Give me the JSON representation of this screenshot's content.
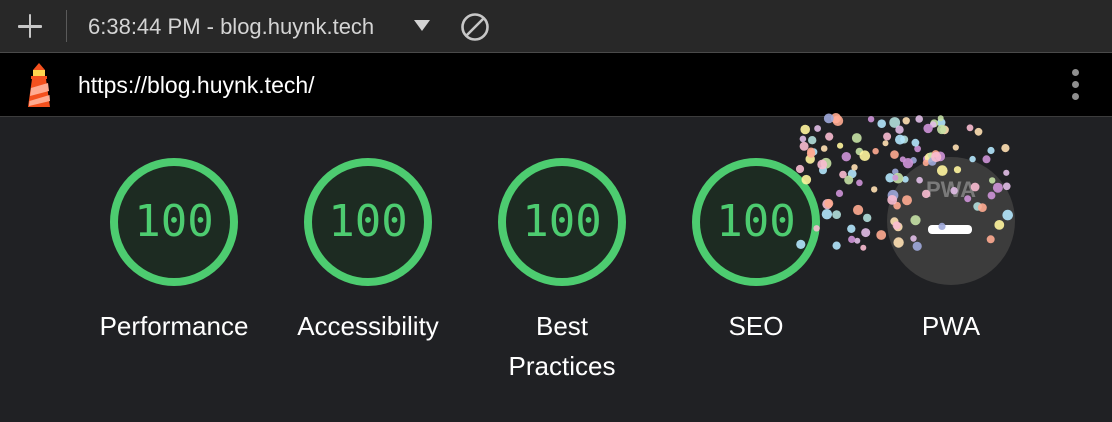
{
  "toolbar": {
    "report_select_value": "6:38:44 PM - blog.huynk.tech",
    "icons": {
      "new": "plus-icon",
      "dropdown": "caret-down-icon",
      "clear": "clear-icon"
    }
  },
  "urlbar": {
    "url": "https://blog.huynk.tech/",
    "icons": {
      "logo": "lighthouse-icon",
      "menu": "kebab-menu-icon"
    }
  },
  "gauges": [
    {
      "score": "100",
      "label": "Performance",
      "value": 1.0
    },
    {
      "score": "100",
      "label": "Accessibility",
      "value": 1.0
    },
    {
      "score": "100",
      "label": "Best Practices",
      "value": 1.0
    },
    {
      "score": "100",
      "label": "SEO",
      "value": 1.0
    }
  ],
  "pwa": {
    "badge_text": "PWA",
    "label": "PWA"
  },
  "colors": {
    "pass": "#4dcc70",
    "gauge_fill": "#1d2b22",
    "pwa_badge": "#3c3c3c",
    "background": "#202124",
    "toolbar": "#282828",
    "url_bar": "#000000"
  }
}
